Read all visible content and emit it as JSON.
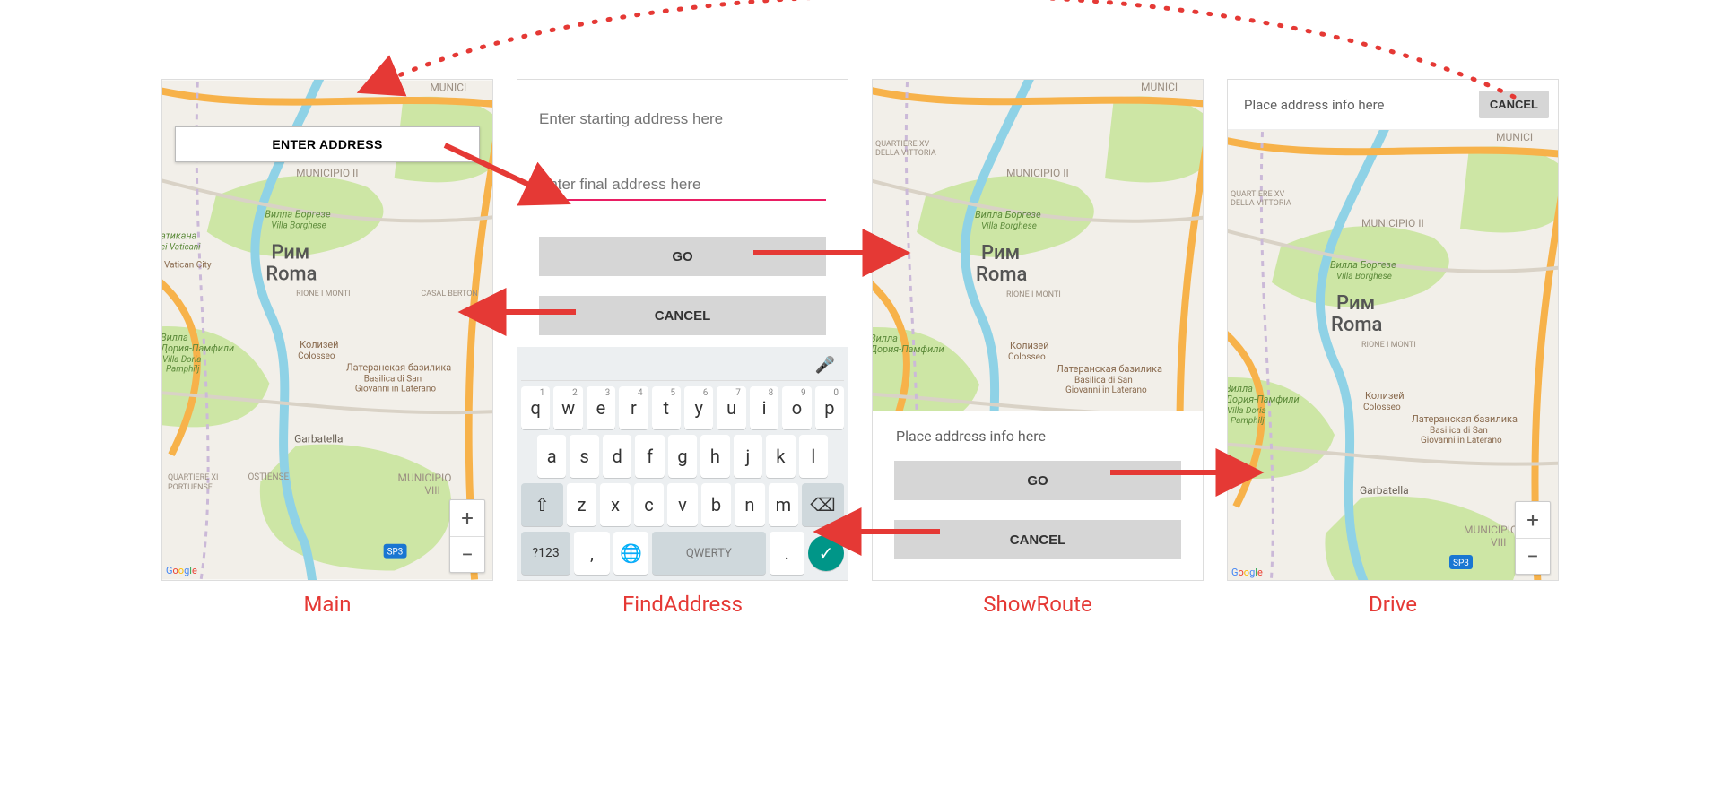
{
  "screens": {
    "main": {
      "label": "Main",
      "enter_address": "ENTER ADDRESS",
      "zoom_in": "+",
      "zoom_out": "−"
    },
    "find_address": {
      "label": "FindAddress",
      "start_placeholder": "Enter starting address here",
      "final_placeholder": "Enter final address here",
      "go": "GO",
      "cancel": "CANCEL",
      "keyboard": {
        "row1": [
          {
            "k": "q",
            "h": "1"
          },
          {
            "k": "w",
            "h": "2"
          },
          {
            "k": "e",
            "h": "3"
          },
          {
            "k": "r",
            "h": "4"
          },
          {
            "k": "t",
            "h": "5"
          },
          {
            "k": "y",
            "h": "6"
          },
          {
            "k": "u",
            "h": "7"
          },
          {
            "k": "i",
            "h": "8"
          },
          {
            "k": "o",
            "h": "9"
          },
          {
            "k": "p",
            "h": "0"
          }
        ],
        "row2": [
          "a",
          "s",
          "d",
          "f",
          "g",
          "h",
          "j",
          "k",
          "l"
        ],
        "row3": [
          "z",
          "x",
          "c",
          "v",
          "b",
          "n",
          "m"
        ],
        "shift": "⇧",
        "backspace": "⌫",
        "symbols": "?123",
        "comma": ",",
        "globe": "🌐",
        "space_label": "QWERTY",
        "period": ".",
        "enter": "✓"
      }
    },
    "show_route": {
      "label": "ShowRoute",
      "placeholder": "Place address info here",
      "go": "GO",
      "cancel": "CANCEL"
    },
    "drive": {
      "label": "Drive",
      "placeholder": "Place address info here",
      "cancel": "CANCEL",
      "zoom_in": "+",
      "zoom_out": "−"
    }
  },
  "map_labels": {
    "rome_cy": "Рим",
    "rome_la": "Roma",
    "municipio2": "MUNICIPIO II",
    "municipio8": "MUNICIPIO\nVIII",
    "munic_cut": "MUNICI",
    "quartiere_xv": "QUARTIERE XV\nDELLA VITTORIA",
    "quartiere_xi": "QUARTIERE XI\nPORTUENSE",
    "ostiense": "OSTIENSE",
    "garbatella": "Garbatella",
    "rione_monti": "RIONE I MONTI",
    "villa_borghese_cy": "Вилла Боргезе",
    "villa_borghese_la": "Villa Borghese",
    "vatican_cy": "Ватикан",
    "vatican_la": "Vatican City",
    "vilaticana": "эатикана\nlei Vaticani",
    "doria_cy": "Вилла\nДория-Памфили",
    "doria_la": "Villa Doria\nPamphilj",
    "colosseum_cy": "Колизей",
    "colosseum_la": "Colosseo",
    "basilica_cy": "Латеранская базилика",
    "basilica_la": "Basilica di San\nGiovanni in Laterano",
    "casal_berton": "CASAL BERTON",
    "sp3": "SP3",
    "attribution": "Google"
  }
}
